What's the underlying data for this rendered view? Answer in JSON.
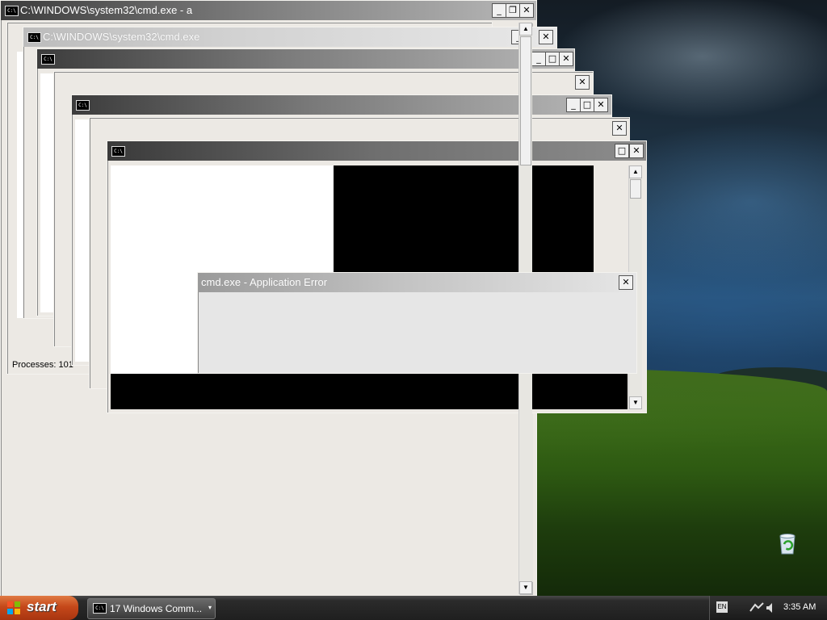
{
  "windows": {
    "cmd_back": {
      "title": "C:\\WINDOWS\\system32\\cmd.exe - a"
    },
    "cmd_second": {
      "title": "C:\\WINDOWS\\system32\\cmd.exe"
    },
    "taskmgr": {
      "status": "Processes: 101"
    },
    "icon_text": "C:\\",
    "minimize": "_",
    "maximize": "□",
    "restore": "❐",
    "close": "✕",
    "scroll_up": "▲",
    "scroll_down": "▼"
  },
  "error_dialog": {
    "title": "cmd.exe - Application Error",
    "close": "✕"
  },
  "taskbar": {
    "start_label": "start",
    "task_label": "17 Windows Comm...",
    "caret": "▾",
    "lang": "EN",
    "clock": "3:35 AM"
  },
  "colors": {
    "start": "#c5481a",
    "title_dark": "#3c3c3c",
    "desktop_grass": "#3a6a17"
  }
}
